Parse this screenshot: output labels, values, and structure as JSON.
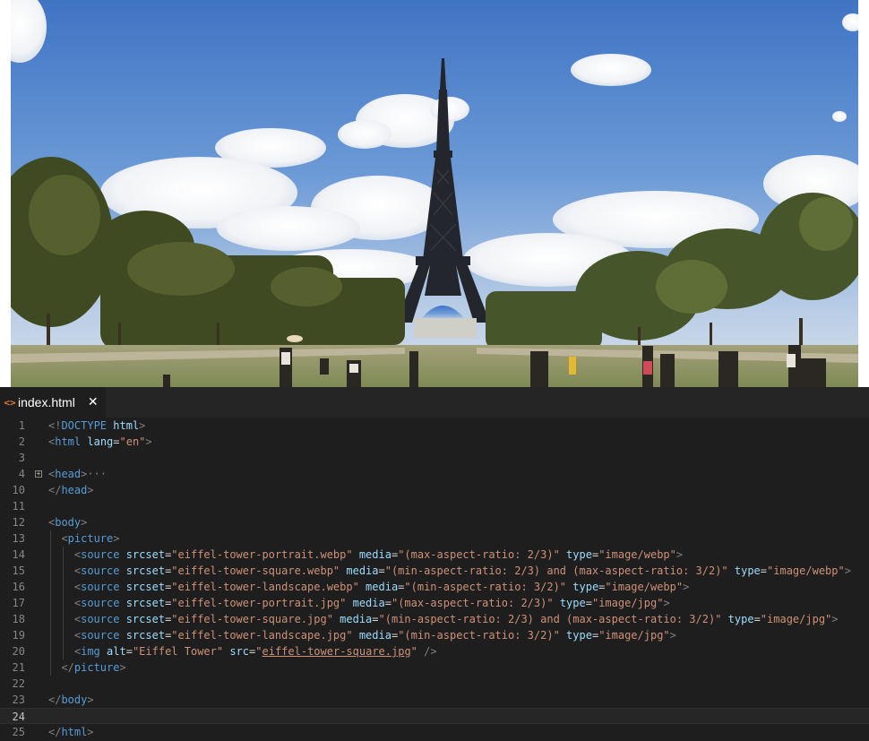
{
  "editor": {
    "tab": {
      "icon": "code-file-icon",
      "label": "index.html",
      "close": "✕"
    },
    "colors": {
      "tag": "#569cd6",
      "attr": "#9cdcfe",
      "string": "#ce9178",
      "bracket": "#808080",
      "background": "#1e1e1e"
    },
    "active_line": 24,
    "lines": [
      {
        "num": "1",
        "indent": 0,
        "tokens": [
          [
            "br",
            "<!"
          ],
          [
            "tag",
            "DOCTYPE"
          ],
          [
            "tx",
            " "
          ],
          [
            "at",
            "html"
          ],
          [
            "br",
            ">"
          ]
        ]
      },
      {
        "num": "2",
        "indent": 0,
        "tokens": [
          [
            "br",
            "<"
          ],
          [
            "tag",
            "html"
          ],
          [
            "tx",
            " "
          ],
          [
            "at",
            "lang"
          ],
          [
            "tx",
            "="
          ],
          [
            "str",
            "\"en\""
          ],
          [
            "br",
            ">"
          ]
        ]
      },
      {
        "num": "3",
        "indent": 0,
        "tokens": []
      },
      {
        "num": "4",
        "indent": 0,
        "fold": "+",
        "tokens": [
          [
            "br",
            "<"
          ],
          [
            "tag",
            "head"
          ],
          [
            "br",
            ">"
          ],
          [
            "br",
            "···"
          ]
        ]
      },
      {
        "num": "10",
        "indent": 0,
        "tokens": [
          [
            "br",
            "</"
          ],
          [
            "tag",
            "head"
          ],
          [
            "br",
            ">"
          ]
        ]
      },
      {
        "num": "11",
        "indent": 0,
        "tokens": []
      },
      {
        "num": "12",
        "indent": 0,
        "tokens": [
          [
            "br",
            "<"
          ],
          [
            "tag",
            "body"
          ],
          [
            "br",
            ">"
          ]
        ]
      },
      {
        "num": "13",
        "indent": 1,
        "tokens": [
          [
            "br",
            "<"
          ],
          [
            "tag",
            "picture"
          ],
          [
            "br",
            ">"
          ]
        ]
      },
      {
        "num": "14",
        "indent": 2,
        "tokens": [
          [
            "br",
            "<"
          ],
          [
            "tag",
            "source"
          ],
          [
            "tx",
            " "
          ],
          [
            "at",
            "srcset"
          ],
          [
            "tx",
            "="
          ],
          [
            "str",
            "\"eiffel-tower-portrait.webp\""
          ],
          [
            "tx",
            " "
          ],
          [
            "at",
            "media"
          ],
          [
            "tx",
            "="
          ],
          [
            "str",
            "\"(max-aspect-ratio: 2/3)\""
          ],
          [
            "tx",
            " "
          ],
          [
            "at",
            "type"
          ],
          [
            "tx",
            "="
          ],
          [
            "str",
            "\"image/webp\""
          ],
          [
            "br",
            ">"
          ]
        ]
      },
      {
        "num": "15",
        "indent": 2,
        "tokens": [
          [
            "br",
            "<"
          ],
          [
            "tag",
            "source"
          ],
          [
            "tx",
            " "
          ],
          [
            "at",
            "srcset"
          ],
          [
            "tx",
            "="
          ],
          [
            "str",
            "\"eiffel-tower-square.webp\""
          ],
          [
            "tx",
            " "
          ],
          [
            "at",
            "media"
          ],
          [
            "tx",
            "="
          ],
          [
            "str",
            "\"(min-aspect-ratio: 2/3) and (max-aspect-ratio: 3/2)\""
          ],
          [
            "tx",
            " "
          ],
          [
            "at",
            "type"
          ],
          [
            "tx",
            "="
          ],
          [
            "str",
            "\"image/webp\""
          ],
          [
            "br",
            ">"
          ]
        ]
      },
      {
        "num": "16",
        "indent": 2,
        "tokens": [
          [
            "br",
            "<"
          ],
          [
            "tag",
            "source"
          ],
          [
            "tx",
            " "
          ],
          [
            "at",
            "srcset"
          ],
          [
            "tx",
            "="
          ],
          [
            "str",
            "\"eiffel-tower-landscape.webp\""
          ],
          [
            "tx",
            " "
          ],
          [
            "at",
            "media"
          ],
          [
            "tx",
            "="
          ],
          [
            "str",
            "\"(min-aspect-ratio: 3/2)\""
          ],
          [
            "tx",
            " "
          ],
          [
            "at",
            "type"
          ],
          [
            "tx",
            "="
          ],
          [
            "str",
            "\"image/webp\""
          ],
          [
            "br",
            ">"
          ]
        ]
      },
      {
        "num": "17",
        "indent": 2,
        "tokens": [
          [
            "br",
            "<"
          ],
          [
            "tag",
            "source"
          ],
          [
            "tx",
            " "
          ],
          [
            "at",
            "srcset"
          ],
          [
            "tx",
            "="
          ],
          [
            "str",
            "\"eiffel-tower-portrait.jpg\""
          ],
          [
            "tx",
            " "
          ],
          [
            "at",
            "media"
          ],
          [
            "tx",
            "="
          ],
          [
            "str",
            "\"(max-aspect-ratio: 2/3)\""
          ],
          [
            "tx",
            " "
          ],
          [
            "at",
            "type"
          ],
          [
            "tx",
            "="
          ],
          [
            "str",
            "\"image/jpg\""
          ],
          [
            "br",
            ">"
          ]
        ]
      },
      {
        "num": "18",
        "indent": 2,
        "tokens": [
          [
            "br",
            "<"
          ],
          [
            "tag",
            "source"
          ],
          [
            "tx",
            " "
          ],
          [
            "at",
            "srcset"
          ],
          [
            "tx",
            "="
          ],
          [
            "str",
            "\"eiffel-tower-square.jpg\""
          ],
          [
            "tx",
            " "
          ],
          [
            "at",
            "media"
          ],
          [
            "tx",
            "="
          ],
          [
            "str",
            "\"(min-aspect-ratio: 2/3) and (max-aspect-ratio: 3/2)\""
          ],
          [
            "tx",
            " "
          ],
          [
            "at",
            "type"
          ],
          [
            "tx",
            "="
          ],
          [
            "str",
            "\"image/jpg\""
          ],
          [
            "br",
            ">"
          ]
        ]
      },
      {
        "num": "19",
        "indent": 2,
        "tokens": [
          [
            "br",
            "<"
          ],
          [
            "tag",
            "source"
          ],
          [
            "tx",
            " "
          ],
          [
            "at",
            "srcset"
          ],
          [
            "tx",
            "="
          ],
          [
            "str",
            "\"eiffel-tower-landscape.jpg\""
          ],
          [
            "tx",
            " "
          ],
          [
            "at",
            "media"
          ],
          [
            "tx",
            "="
          ],
          [
            "str",
            "\"(min-aspect-ratio: 3/2)\""
          ],
          [
            "tx",
            " "
          ],
          [
            "at",
            "type"
          ],
          [
            "tx",
            "="
          ],
          [
            "str",
            "\"image/jpg\""
          ],
          [
            "br",
            ">"
          ]
        ]
      },
      {
        "num": "20",
        "indent": 2,
        "tokens": [
          [
            "br",
            "<"
          ],
          [
            "tag",
            "img"
          ],
          [
            "tx",
            " "
          ],
          [
            "at",
            "alt"
          ],
          [
            "tx",
            "="
          ],
          [
            "str",
            "\"Eiffel Tower\""
          ],
          [
            "tx",
            " "
          ],
          [
            "at",
            "src"
          ],
          [
            "tx",
            "="
          ],
          [
            "str",
            "\""
          ],
          [
            "stru",
            "eiffel-tower-square.jpg"
          ],
          [
            "str",
            "\""
          ],
          [
            "tx",
            " "
          ],
          [
            "br",
            "/>"
          ]
        ]
      },
      {
        "num": "21",
        "indent": 1,
        "tokens": [
          [
            "br",
            "</"
          ],
          [
            "tag",
            "picture"
          ],
          [
            "br",
            ">"
          ]
        ]
      },
      {
        "num": "22",
        "indent": 0,
        "tokens": []
      },
      {
        "num": "23",
        "indent": 0,
        "tokens": [
          [
            "br",
            "</"
          ],
          [
            "tag",
            "body"
          ],
          [
            "br",
            ">"
          ]
        ]
      },
      {
        "num": "24",
        "indent": 0,
        "tokens": []
      },
      {
        "num": "25",
        "indent": 0,
        "tokens": [
          [
            "br",
            "</"
          ],
          [
            "tag",
            "html"
          ],
          [
            "br",
            ">"
          ]
        ]
      }
    ]
  }
}
